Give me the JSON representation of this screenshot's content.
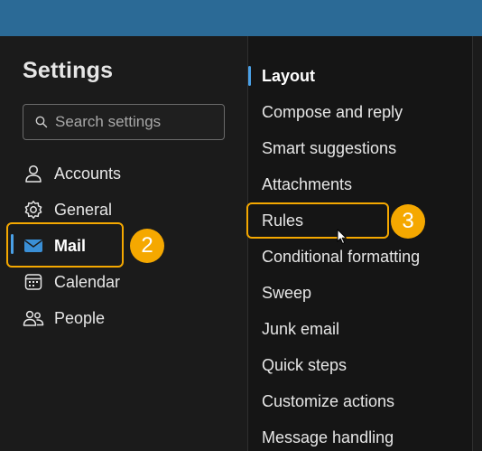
{
  "colors": {
    "topbar": "#2b6a96",
    "accent_indicator": "#4aa0e6",
    "highlight": "#f5a800",
    "text": "#e6e6e6"
  },
  "settings": {
    "title": "Settings",
    "search_placeholder": "Search settings"
  },
  "nav": [
    {
      "label": "Accounts",
      "icon": "person-icon"
    },
    {
      "label": "General",
      "icon": "gear-icon"
    },
    {
      "label": "Mail",
      "icon": "mail-icon",
      "active": true
    },
    {
      "label": "Calendar",
      "icon": "calendar-icon"
    },
    {
      "label": "People",
      "icon": "people-icon"
    }
  ],
  "submenu": [
    {
      "label": "Layout",
      "active": true
    },
    {
      "label": "Compose and reply"
    },
    {
      "label": "Smart suggestions"
    },
    {
      "label": "Attachments"
    },
    {
      "label": "Rules"
    },
    {
      "label": "Conditional formatting"
    },
    {
      "label": "Sweep"
    },
    {
      "label": "Junk email"
    },
    {
      "label": "Quick steps"
    },
    {
      "label": "Customize actions"
    },
    {
      "label": "Message handling"
    }
  ],
  "callouts": {
    "step_mail": "2",
    "step_rules": "3"
  }
}
